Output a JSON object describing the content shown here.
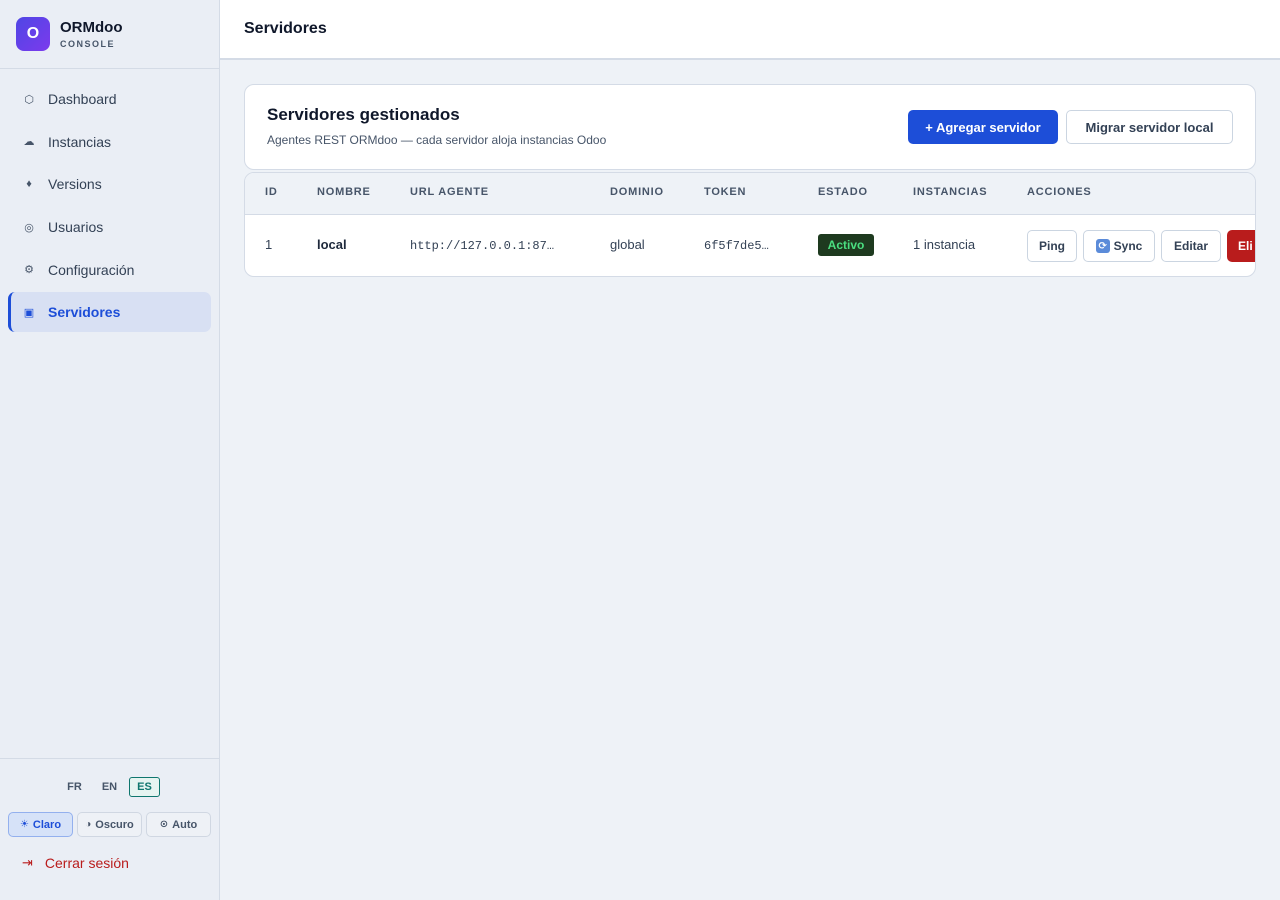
{
  "brand": {
    "initial": "O",
    "name": "ORMdoo",
    "subtitle": "CONSOLE"
  },
  "nav": [
    {
      "label": "Dashboard",
      "icon": "hexagon-icon",
      "glyph": "⬡",
      "active": false
    },
    {
      "label": "Instancias",
      "icon": "cloud-icon",
      "glyph": "☁",
      "active": false
    },
    {
      "label": "Versions",
      "icon": "diamond-icon",
      "glyph": "♦",
      "active": false
    },
    {
      "label": "Usuarios",
      "icon": "users-icon",
      "glyph": "◎",
      "active": false
    },
    {
      "label": "Configuración",
      "icon": "gear-icon",
      "glyph": "⚙",
      "active": false
    },
    {
      "label": "Servidores",
      "icon": "server-icon",
      "glyph": "▣",
      "active": true
    }
  ],
  "languages": [
    {
      "code": "FR",
      "active": false
    },
    {
      "code": "EN",
      "active": false
    },
    {
      "code": "ES",
      "active": true
    }
  ],
  "themes": [
    {
      "label": "Claro",
      "glyph": "☀",
      "active": true
    },
    {
      "label": "Oscuro",
      "glyph": "◑",
      "active": false
    },
    {
      "label": "Auto",
      "glyph": "⊙",
      "active": false
    }
  ],
  "logout": {
    "label": "Cerrar sesión",
    "glyph": "⇥"
  },
  "topbar": {
    "title": "Servidores"
  },
  "card": {
    "title": "Servidores gestionados",
    "subtitle": "Agentes REST ORMdoo — cada servidor aloja instancias Odoo",
    "add_label": "+ Agregar servidor",
    "migrate_label": "Migrar servidor local"
  },
  "table": {
    "headers": [
      "ID",
      "NOMBRE",
      "URL AGENTE",
      "DOMINIO",
      "TOKEN",
      "ESTADO",
      "INSTANCIAS",
      "ACCIONES"
    ],
    "rows": [
      {
        "id": "1",
        "name": "local",
        "url": "http://127.0.0.1:87…",
        "domain": "global",
        "token": "6f5f7de5…",
        "status": "Activo",
        "instances": "1 instancia",
        "actions": {
          "ping": "Ping",
          "sync": "Sync",
          "edit": "Editar",
          "delete": "Eli"
        }
      }
    ]
  },
  "colors": {
    "accent": "#1d4ed8",
    "danger": "#b91c1c",
    "success_badge_bg": "#1e3a1f",
    "success_badge_text": "#4ade80"
  }
}
